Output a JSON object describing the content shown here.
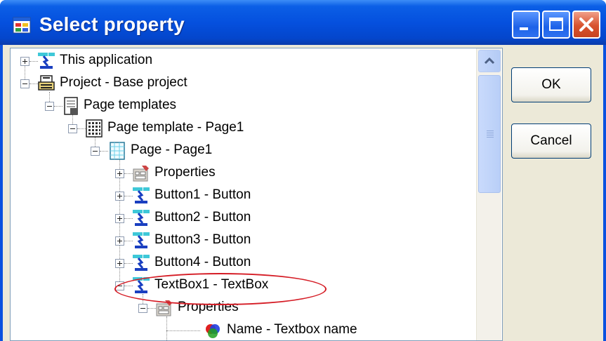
{
  "window": {
    "title": "Select property",
    "title_color": "#ffffff",
    "titlebar_color": "#0550de"
  },
  "tree": {
    "nodes": [
      {
        "label": "This application",
        "icon": "application-icon",
        "expander": "plus"
      },
      {
        "label": "Project - Base project",
        "icon": "project-icon",
        "expander": "minus"
      },
      {
        "label": "Page templates",
        "icon": "page-templates-icon",
        "expander": "minus"
      },
      {
        "label": "Page template - Page1",
        "icon": "page-template-icon",
        "expander": "minus"
      },
      {
        "label": "Page - Page1",
        "icon": "page-icon",
        "expander": "minus"
      },
      {
        "label": "Properties",
        "icon": "properties-icon",
        "expander": "plus"
      },
      {
        "label": "Button1 - Button",
        "icon": "control-icon",
        "expander": "plus"
      },
      {
        "label": "Button2 - Button",
        "icon": "control-icon",
        "expander": "plus"
      },
      {
        "label": "Button3 - Button",
        "icon": "control-icon",
        "expander": "plus"
      },
      {
        "label": "Button4 - Button",
        "icon": "control-icon",
        "expander": "plus"
      },
      {
        "label": "TextBox1 - TextBox",
        "icon": "control-icon",
        "expander": "minus",
        "highlighted": true
      },
      {
        "label": "Properties",
        "icon": "properties-icon",
        "expander": "minus"
      },
      {
        "label": "Name - Textbox name",
        "icon": "property-value-icon",
        "expander": "none"
      }
    ]
  },
  "buttons": {
    "ok_label": "OK",
    "cancel_label": "Cancel"
  },
  "highlight_color": "#d51c25"
}
